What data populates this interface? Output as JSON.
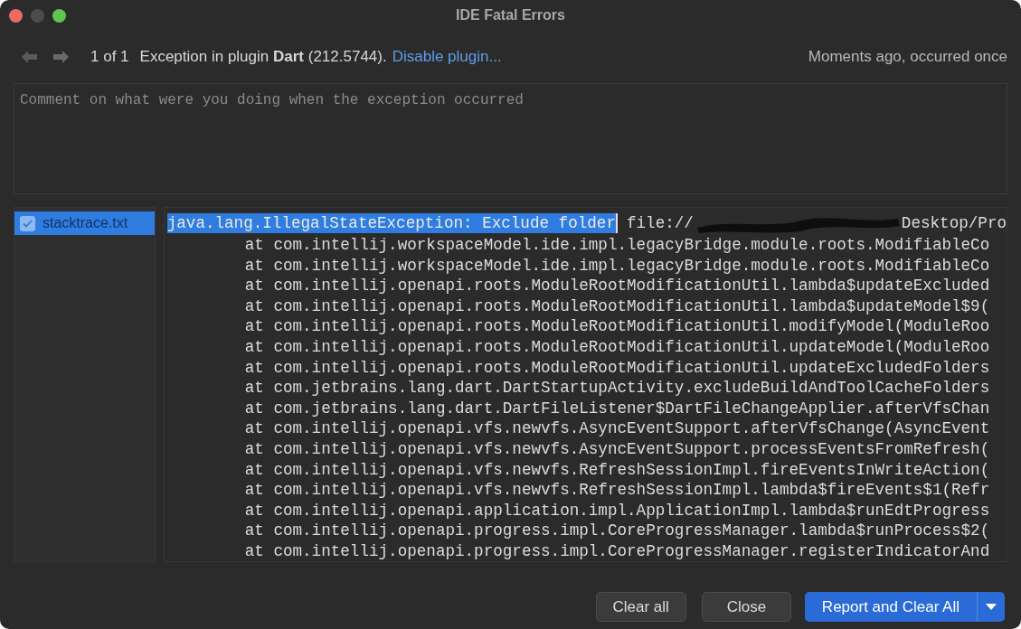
{
  "window": {
    "title": "IDE Fatal Errors"
  },
  "navigator": {
    "counter": "1 of 1",
    "message": "Exception in plugin **Dart** (212.5744).",
    "link": "Disable plugin...",
    "timestamp": "Moments ago, occurred once"
  },
  "comment": {
    "placeholder": "Comment on what were you doing when the exception occurred"
  },
  "attachments": [
    {
      "name": "stacktrace.txt",
      "checked": true,
      "selected": true
    }
  ],
  "stacktrace": {
    "selected_text": "java.lang.IllegalStateException: Exclude folder",
    "first_line_rest": "file://",
    "first_line_after_redaction": "Desktop/Pro",
    "frames": [
      "at com.intellij.workspaceModel.ide.impl.legacyBridge.module.roots.ModifiableCo",
      "at com.intellij.workspaceModel.ide.impl.legacyBridge.module.roots.ModifiableCo",
      "at com.intellij.openapi.roots.ModuleRootModificationUtil.lambda$updateExcluded",
      "at com.intellij.openapi.roots.ModuleRootModificationUtil.lambda$updateModel$9(",
      "at com.intellij.openapi.roots.ModuleRootModificationUtil.modifyModel(ModuleRoo",
      "at com.intellij.openapi.roots.ModuleRootModificationUtil.updateModel(ModuleRoo",
      "at com.intellij.openapi.roots.ModuleRootModificationUtil.updateExcludedFolders",
      "at com.jetbrains.lang.dart.DartStartupActivity.excludeBuildAndToolCacheFolders",
      "at com.jetbrains.lang.dart.DartFileListener$DartFileChangeApplier.afterVfsChan",
      "at com.intellij.openapi.vfs.newvfs.AsyncEventSupport.afterVfsChange(AsyncEvent",
      "at com.intellij.openapi.vfs.newvfs.AsyncEventSupport.processEventsFromRefresh(",
      "at com.intellij.openapi.vfs.newvfs.RefreshSessionImpl.fireEventsInWriteAction(",
      "at com.intellij.openapi.vfs.newvfs.RefreshSessionImpl.lambda$fireEvents$1(Refr",
      "at com.intellij.openapi.application.impl.ApplicationImpl.lambda$runEdtProgress",
      "at com.intellij.openapi.progress.impl.CoreProgressManager.lambda$runProcess$2(",
      "at com.intellij.openapi.progress.impl.CoreProgressManager.registerIndicatorAnd"
    ]
  },
  "buttons": [
    {
      "label": "Clear all",
      "kind": "secondary"
    },
    {
      "label": "Close",
      "kind": "secondary"
    },
    {
      "label": "Report and Clear All",
      "kind": "primary"
    }
  ]
}
